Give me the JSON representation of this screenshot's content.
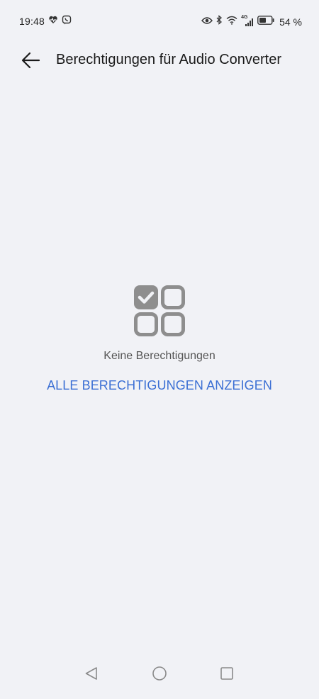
{
  "status_bar": {
    "time": "19:48",
    "battery_percent": "54 %",
    "network_label": "4G",
    "icons": [
      "heart-pulse-icon",
      "viber-icon",
      "eye-icon",
      "bluetooth-icon",
      "wifi-icon",
      "signal-icon",
      "battery-icon"
    ]
  },
  "app_bar": {
    "title": "Berechtigungen für Audio Converter",
    "back_icon": "arrow-left-icon"
  },
  "empty_state": {
    "icon": "permissions-grid-icon",
    "message": "Keine Berechtigungen",
    "show_all_label": "ALLE BERECHTIGUNGEN ANZEIGEN"
  },
  "nav_bar": {
    "icons": [
      "back-triangle-icon",
      "home-circle-icon",
      "recents-square-icon"
    ]
  },
  "colors": {
    "background": "#f1f2f6",
    "link": "#3b6fd4",
    "icon_gray": "#8e8e8e"
  }
}
